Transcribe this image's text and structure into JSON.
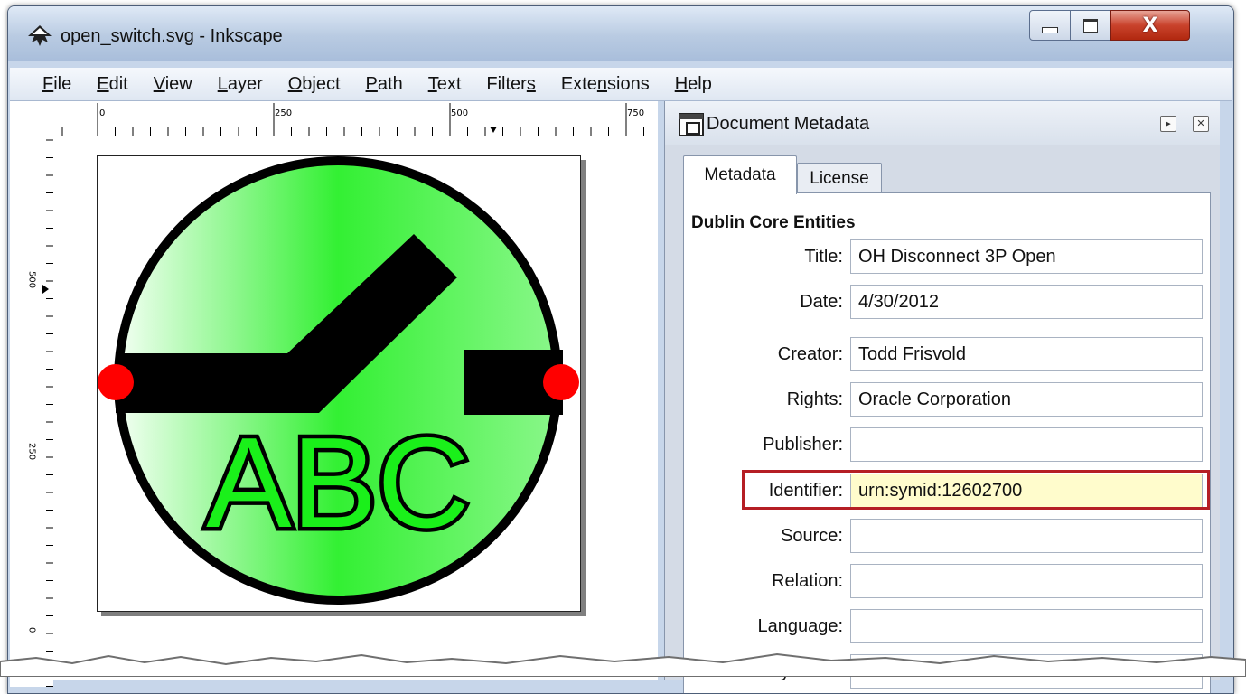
{
  "window": {
    "title": "open_switch.svg - Inkscape",
    "close_glyph": "X"
  },
  "menu": [
    {
      "pre": "",
      "u": "F",
      "post": "ile"
    },
    {
      "pre": "",
      "u": "E",
      "post": "dit"
    },
    {
      "pre": "",
      "u": "V",
      "post": "iew"
    },
    {
      "pre": "",
      "u": "L",
      "post": "ayer"
    },
    {
      "pre": "",
      "u": "O",
      "post": "bject"
    },
    {
      "pre": "",
      "u": "P",
      "post": "ath"
    },
    {
      "pre": "",
      "u": "T",
      "post": "ext"
    },
    {
      "pre": "Filter",
      "u": "s",
      "post": ""
    },
    {
      "pre": "Exte",
      "u": "n",
      "post": "sions"
    },
    {
      "pre": "",
      "u": "H",
      "post": "elp"
    }
  ],
  "rulers": {
    "horizontal_labels": [
      "0",
      "250",
      "500",
      "750"
    ],
    "vertical_labels": [
      "500",
      "250",
      "0"
    ]
  },
  "drawing": {
    "text": "ABC",
    "fill_color": "#3ef03e",
    "terminal_color": "#ff0000"
  },
  "dock": {
    "title": "Document Metadata",
    "tabs": [
      "Metadata",
      "License"
    ],
    "section_title": "Dublin Core Entities",
    "fields": [
      {
        "label": "Title:",
        "value": "OH Disconnect 3P Open"
      },
      {
        "label": "Date:",
        "value": "4/30/2012"
      },
      {
        "label": "Creator:",
        "value": "Todd Frisvold"
      },
      {
        "label": "Rights:",
        "value": "Oracle Corporation"
      },
      {
        "label": "Publisher:",
        "value": ""
      },
      {
        "label": "Identifier:",
        "value": "urn:symid:12602700"
      },
      {
        "label": "Source:",
        "value": ""
      },
      {
        "label": "Relation:",
        "value": ""
      },
      {
        "label": "Language:",
        "value": ""
      },
      {
        "label": "Keywords:",
        "value": ""
      }
    ],
    "highlight_color": "#b51e24"
  }
}
